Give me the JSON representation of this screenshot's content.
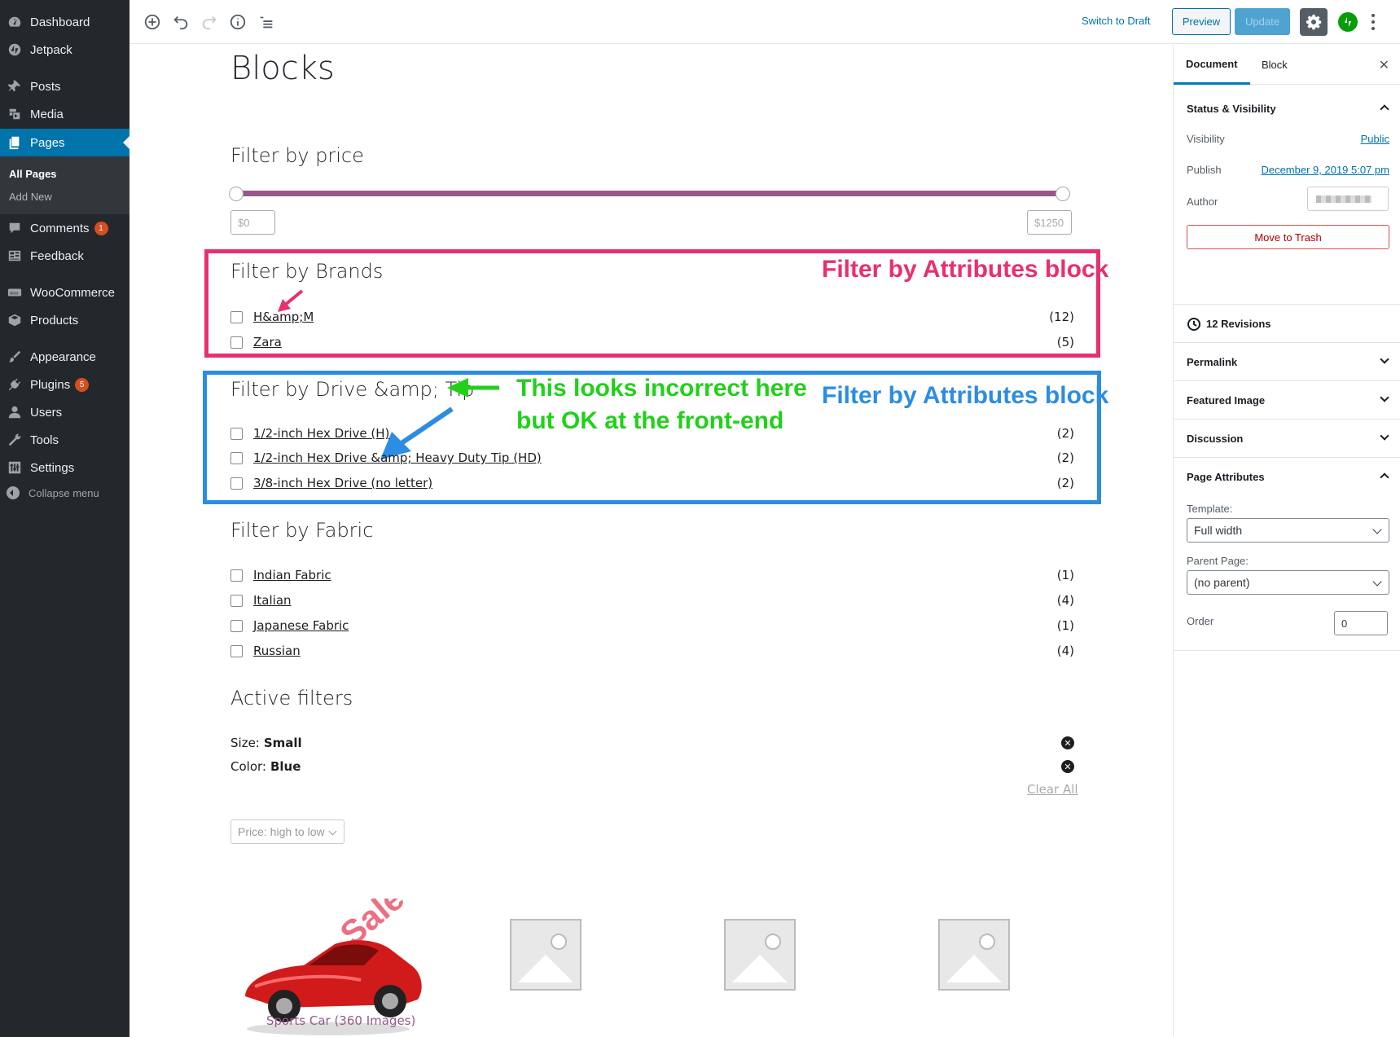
{
  "admin_menu": {
    "items": [
      {
        "label": "Dashboard",
        "icon": "dashboard-icon"
      },
      {
        "label": "Jetpack",
        "icon": "jetpack-icon"
      },
      {
        "label": "Posts",
        "icon": "pushpin-icon"
      },
      {
        "label": "Media",
        "icon": "media-icon"
      },
      {
        "label": "Pages",
        "icon": "pages-icon",
        "active": true
      },
      {
        "label": "Comments",
        "icon": "comments-icon",
        "badge": "1"
      },
      {
        "label": "Feedback",
        "icon": "feedback-icon"
      },
      {
        "label": "WooCommerce",
        "icon": "woocommerce-icon"
      },
      {
        "label": "Products",
        "icon": "products-icon"
      },
      {
        "label": "Appearance",
        "icon": "appearance-icon"
      },
      {
        "label": "Plugins",
        "icon": "plugins-icon",
        "badge": "5"
      },
      {
        "label": "Users",
        "icon": "users-icon"
      },
      {
        "label": "Tools",
        "icon": "tools-icon"
      },
      {
        "label": "Settings",
        "icon": "settings-icon"
      }
    ],
    "submenu": {
      "all_pages": "All Pages",
      "add_new": "Add New"
    },
    "collapse": "Collapse menu"
  },
  "toolbar": {
    "switch_to_draft": "Switch to Draft",
    "preview": "Preview",
    "update": "Update"
  },
  "editor": {
    "page_title": "Blocks",
    "price_filter": {
      "heading": "Filter by price",
      "min": "$0",
      "max": "$1250"
    },
    "brands": {
      "heading": "Filter by Brands",
      "items": [
        {
          "label": "H&amp;M",
          "count": "(12)"
        },
        {
          "label": "Zara",
          "count": "(5)"
        }
      ]
    },
    "drive": {
      "heading": "Filter by Drive &amp; Tip",
      "items": [
        {
          "label": "1/2-inch Hex Drive (H)",
          "count": "(2)"
        },
        {
          "label": "1/2-inch Hex Drive &amp; Heavy Duty Tip (HD)",
          "count": "(2)"
        },
        {
          "label": "3/8-inch Hex Drive (no letter)",
          "count": "(2)"
        }
      ]
    },
    "fabric": {
      "heading": "Filter by Fabric",
      "items": [
        {
          "label": "Indian Fabric",
          "count": "(1)"
        },
        {
          "label": "Italian",
          "count": "(4)"
        },
        {
          "label": "Japanese Fabric",
          "count": "(1)"
        },
        {
          "label": "Russian",
          "count": "(4)"
        }
      ]
    },
    "active_filters": {
      "heading": "Active filters",
      "items": [
        {
          "key": "Size:",
          "value": "Small"
        },
        {
          "key": "Color:",
          "value": "Blue"
        }
      ],
      "clear_all": "Clear All"
    },
    "sort": "Price: high to low",
    "product_title": "Sports Car (360 Images)",
    "watermark": "Sale"
  },
  "annotations": {
    "red_label": "Filter by Attributes block",
    "blue_label": "Filter by Attributes block",
    "green_line1": "This looks incorrect here",
    "green_line2": "but OK at the front-end",
    "colors": {
      "red": "#e8306c",
      "blue": "#2b8de3",
      "green": "#22d01c"
    }
  },
  "panel": {
    "tabs": {
      "document": "Document",
      "block": "Block"
    },
    "status": {
      "title": "Status & Visibility",
      "visibility_label": "Visibility",
      "visibility_value": "Public",
      "publish_label": "Publish",
      "publish_value": "December 9, 2019 5:07 pm",
      "author_label": "Author",
      "trash": "Move to Trash"
    },
    "revisions": "12 Revisions",
    "permalink": "Permalink",
    "featured_image": "Featured Image",
    "discussion": "Discussion",
    "page_attributes": {
      "title": "Page Attributes",
      "template_label": "Template:",
      "template_value": "Full width",
      "parent_label": "Parent Page:",
      "parent_value": "(no parent)",
      "order_label": "Order",
      "order_value": "0"
    }
  },
  "theme": {
    "accent": "#0073aa",
    "admin_bg": "#23282d",
    "woo_purple": "#96588a"
  }
}
